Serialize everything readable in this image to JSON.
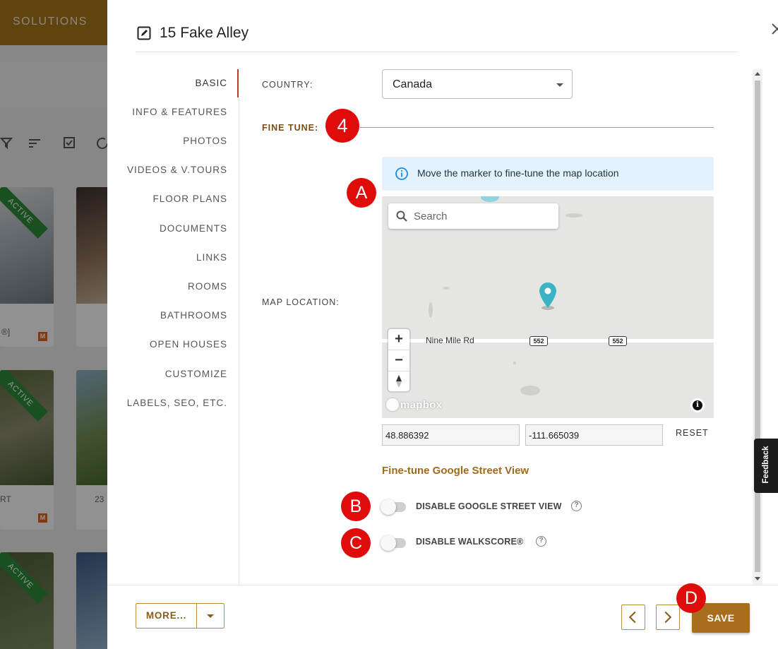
{
  "background": {
    "top_nav_label": "SOLUTIONS",
    "ribbon_label": "ACTIVE",
    "mark_letter": "M",
    "card_texts": [
      "®]",
      "RT",
      "23"
    ]
  },
  "modal": {
    "title": "15 Fake Alley",
    "nav": [
      {
        "label": "BASIC"
      },
      {
        "label": "INFO & FEATURES"
      },
      {
        "label": "PHOTOS"
      },
      {
        "label": "VIDEOS & V.TOURS"
      },
      {
        "label": "FLOOR PLANS"
      },
      {
        "label": "DOCUMENTS"
      },
      {
        "label": "LINKS"
      },
      {
        "label": "ROOMS"
      },
      {
        "label": "BATHROOMS"
      },
      {
        "label": "OPEN HOUSES"
      },
      {
        "label": "CUSTOMIZE"
      },
      {
        "label": "LABELS, SEO, ETC."
      }
    ],
    "active_nav": "BASIC"
  },
  "form": {
    "country_label": "COUNTRY:",
    "country_value": "Canada",
    "fine_tune_label": "FINE TUNE:",
    "map_location_label": "MAP LOCATION:",
    "info_message": "Move the marker to fine-tune the map location",
    "map": {
      "search_placeholder": "Search",
      "road_name": "Nine Mile Rd",
      "road_shields": [
        "552",
        "552"
      ],
      "zoom_in": "+",
      "zoom_out": "−",
      "logo_text": "mapbox",
      "attribution": "i"
    },
    "latitude": "48.886392",
    "longitude": "-111.665039",
    "reset_label": "RESET",
    "street_view_link": "Fine-tune Google Street View",
    "toggles": {
      "street_view": {
        "label": "DISABLE GOOGLE STREET VIEW",
        "on": false
      },
      "walkscore": {
        "label": "DISABLE WALKSCORE®",
        "on": false
      }
    },
    "help_glyph": "?"
  },
  "annotations": {
    "step_number": "4",
    "A": "A",
    "B": "B",
    "C": "C",
    "D": "D"
  },
  "footer": {
    "more_label": "MORE...",
    "save_label": "SAVE"
  },
  "feedback_label": "Feedback",
  "colors": {
    "accent": "#a86e1e",
    "badge_red": "#e00b0b",
    "info_bg": "#e3f2fc",
    "active_ribbon": "#2e8b3a",
    "marker": "#3bb3c3"
  }
}
